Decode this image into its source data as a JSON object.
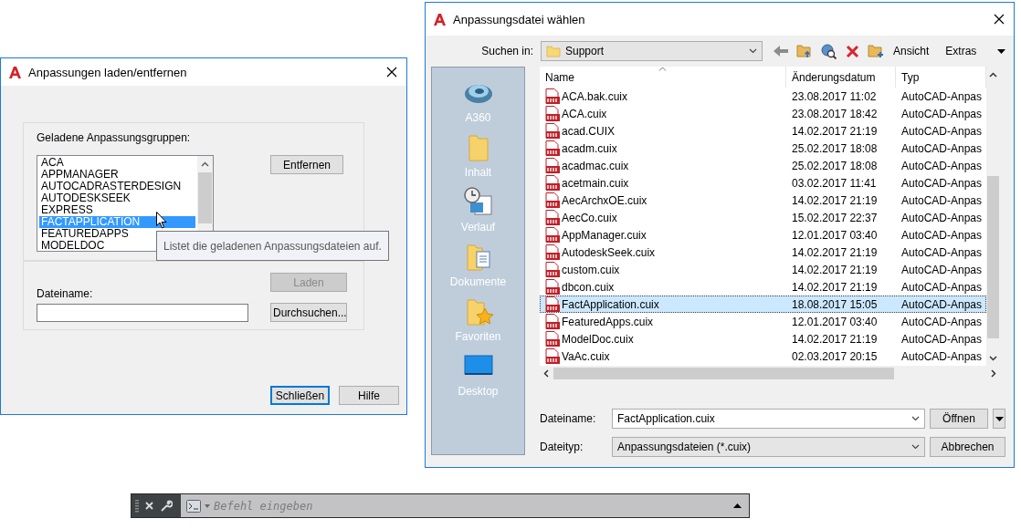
{
  "load_dialog": {
    "title": "Anpassungen laden/entfernen",
    "group_label": "Geladene Anpassungsgruppen:",
    "groups": [
      {
        "label": "ACA",
        "selected": false
      },
      {
        "label": "APPMANAGER",
        "selected": false
      },
      {
        "label": "AUTOCADRASTERDESIGN",
        "selected": false
      },
      {
        "label": "AUTODESKSEEK",
        "selected": false
      },
      {
        "label": "EXPRESS",
        "selected": false
      },
      {
        "label": "FACTAPPLICATION",
        "selected": true
      },
      {
        "label": "FEATUREDAPPS",
        "selected": false
      },
      {
        "label": "MODELDOC",
        "selected": false
      }
    ],
    "tooltip": "Listet die geladenen Anpassungsdateien auf.",
    "remove_button": {
      "label": "Entfernen",
      "disabled": false
    },
    "load_button": {
      "label": "Laden",
      "disabled": true
    },
    "filename_label": "Dateiname:",
    "browse_button": {
      "label": "Durchsuchen...",
      "disabled": false
    },
    "buttons": [
      {
        "label": "Schließen",
        "default": true
      },
      {
        "label": "Hilfe",
        "default": false
      }
    ]
  },
  "file_dialog": {
    "title": "Anpassungsdatei wählen",
    "look_in_label": "Suchen in:",
    "look_in_value": "Support",
    "toolbar_menus": [
      "Ansicht",
      "Extras"
    ],
    "places": [
      {
        "kind": "cloud",
        "label": "A360"
      },
      {
        "kind": "folder",
        "label": "Inhalt"
      },
      {
        "kind": "history",
        "label": "Verlauf"
      },
      {
        "kind": "documents",
        "label": "Dokumente"
      },
      {
        "kind": "favorites",
        "label": "Favoriten"
      },
      {
        "kind": "desktop",
        "label": "Desktop"
      }
    ],
    "columns": [
      "Name",
      "Änderungsdatum",
      "Typ"
    ],
    "rows": [
      {
        "name": "ACA.bak.cuix",
        "date": "23.08.2017 11:02",
        "type": "AutoCAD-Anpas",
        "selected": false
      },
      {
        "name": "ACA.cuix",
        "date": "23.08.2017 18:42",
        "type": "AutoCAD-Anpas",
        "selected": false
      },
      {
        "name": "acad.CUIX",
        "date": "14.02.2017 21:19",
        "type": "AutoCAD-Anpas",
        "selected": false
      },
      {
        "name": "acadm.cuix",
        "date": "25.02.2017 18:08",
        "type": "AutoCAD-Anpas",
        "selected": false
      },
      {
        "name": "acadmac.cuix",
        "date": "25.02.2017 18:08",
        "type": "AutoCAD-Anpas",
        "selected": false
      },
      {
        "name": "acetmain.cuix",
        "date": "03.02.2017 11:41",
        "type": "AutoCAD-Anpas",
        "selected": false
      },
      {
        "name": "AecArchxOE.cuix",
        "date": "14.02.2017 21:19",
        "type": "AutoCAD-Anpas",
        "selected": false
      },
      {
        "name": "AecCo.cuix",
        "date": "15.02.2017 22:37",
        "type": "AutoCAD-Anpas",
        "selected": false
      },
      {
        "name": "AppManager.cuix",
        "date": "12.01.2017 03:40",
        "type": "AutoCAD-Anpas",
        "selected": false
      },
      {
        "name": "AutodeskSeek.cuix",
        "date": "14.02.2017 21:19",
        "type": "AutoCAD-Anpas",
        "selected": false
      },
      {
        "name": "custom.cuix",
        "date": "14.02.2017 21:19",
        "type": "AutoCAD-Anpas",
        "selected": false
      },
      {
        "name": "dbcon.cuix",
        "date": "14.02.2017 21:19",
        "type": "AutoCAD-Anpas",
        "selected": false
      },
      {
        "name": "FactApplication.cuix",
        "date": "18.08.2017 15:05",
        "type": "AutoCAD-Anpas",
        "selected": true
      },
      {
        "name": "FeaturedApps.cuix",
        "date": "12.01.2017 03:40",
        "type": "AutoCAD-Anpas",
        "selected": false
      },
      {
        "name": "ModelDoc.cuix",
        "date": "14.02.2017 21:19",
        "type": "AutoCAD-Anpas",
        "selected": false
      },
      {
        "name": "VaAc.cuix",
        "date": "02.03.2017 20:15",
        "type": "AutoCAD-Anpas",
        "selected": false
      }
    ],
    "filename_label": "Dateiname:",
    "filename_value": "FactApplication.cuix",
    "filetype_label": "Dateityp:",
    "filetype_value": "Anpassungsdateien (*.cuix)",
    "buttons": [
      "Öffnen",
      "Abbrechen"
    ]
  },
  "command_line": {
    "placeholder": "Befehl eingeben"
  }
}
